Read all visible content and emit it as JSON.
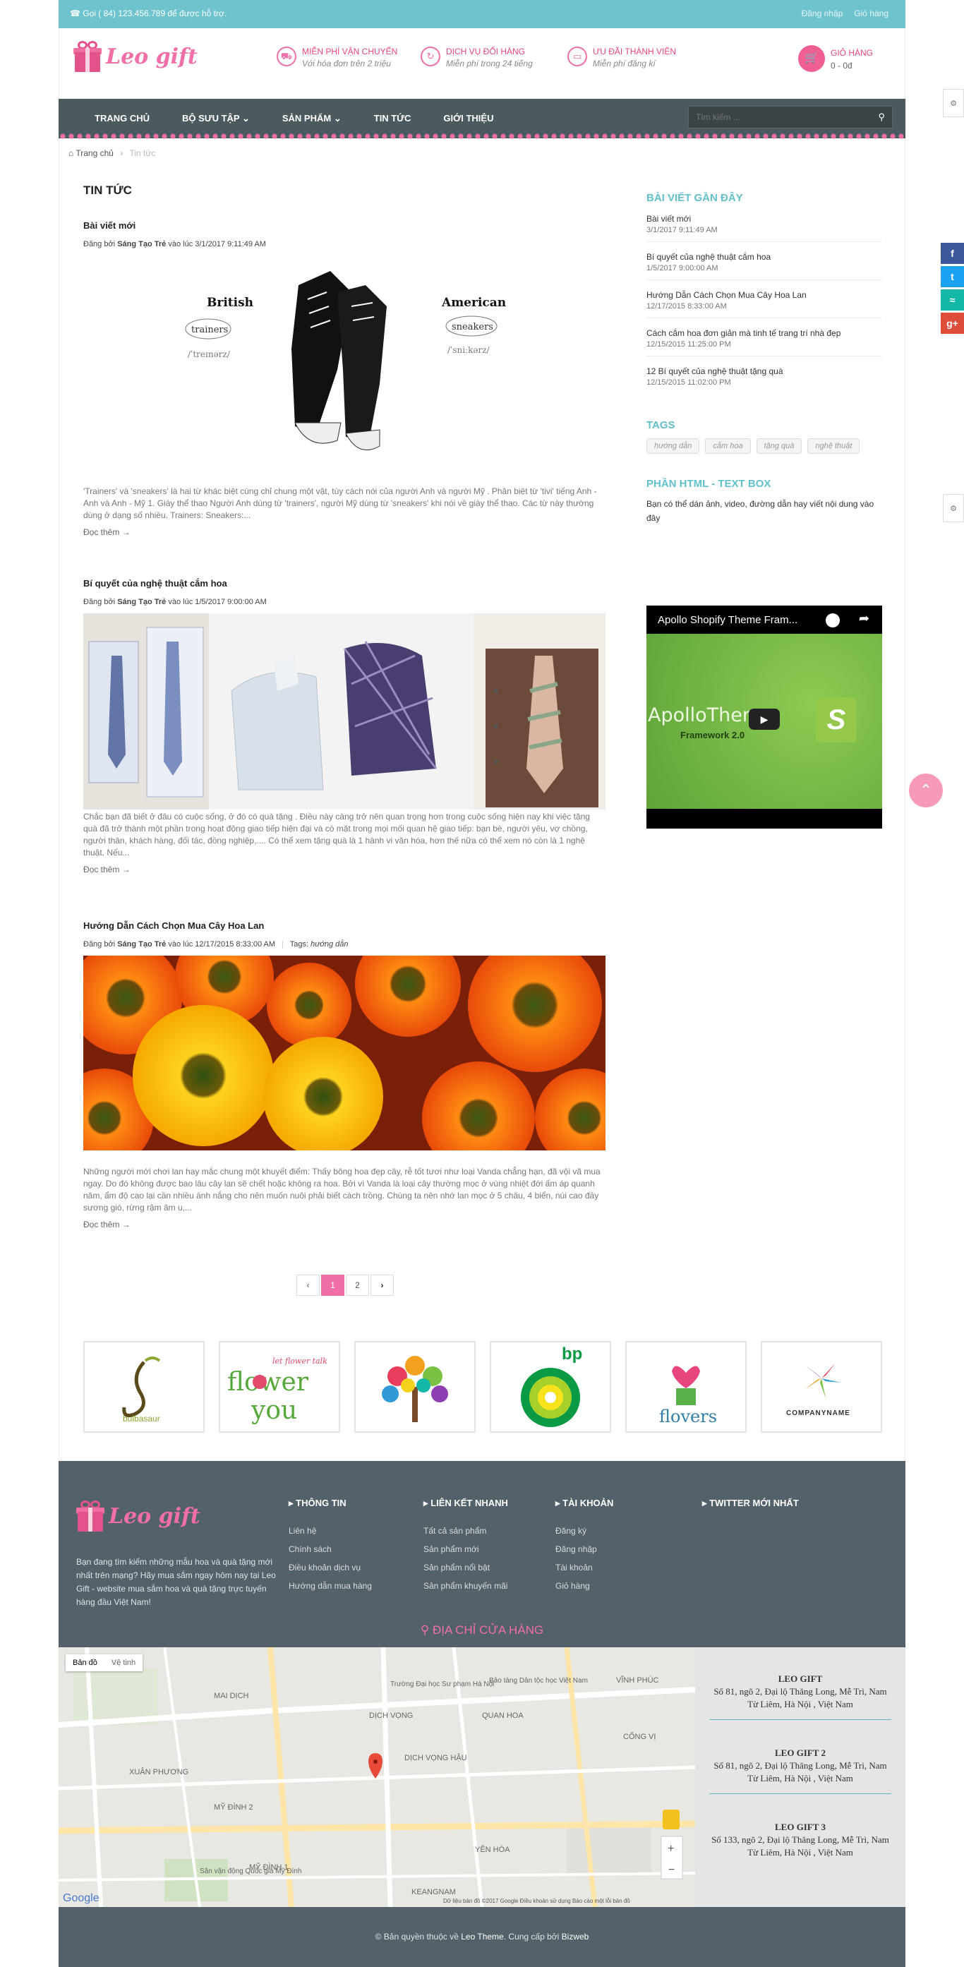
{
  "topbar": {
    "hotline": "Gọi ( 84) 123.456.789 để được hỗ trợ.",
    "login": "Đăng nhập",
    "cart": "Giỏ hàng"
  },
  "header": {
    "logo": "Leo gift",
    "features": [
      {
        "title": "MIỄN PHÍ VẬN CHUYỂN",
        "sub": "Với hóa đơn trên 2 triệu",
        "icon": "truck-icon"
      },
      {
        "title": "DỊCH VỤ ĐỔI HÀNG",
        "sub": "Miễn phí trong 24 tiếng",
        "icon": "refresh-icon"
      },
      {
        "title": "ƯU ĐÃI THÀNH VIÊN",
        "sub": "Miễn phí đăng kí",
        "icon": "card-icon"
      }
    ],
    "cart_title": "GIỎ HÀNG",
    "cart_count": "0 - 0đ"
  },
  "nav": {
    "items": [
      "TRANG CHỦ",
      "BỘ SƯU TẬP",
      "SẢN PHẨM",
      "TIN TỨC",
      "GIỚI THIỆU"
    ],
    "search_placeholder": "Tìm kiếm ..."
  },
  "breadcrumb": {
    "home": "Trang chủ",
    "current": "Tin tức"
  },
  "page_title": "TIN TỨC",
  "posts": [
    {
      "title": "Bài viết mới",
      "meta_prefix": "Đăng bởi",
      "author": "Sáng Tạo Trẻ",
      "date": "vào lúc 3/1/2017 9:11:49 AM",
      "tags_label": "",
      "tag": "",
      "excerpt": "'Trainers' và 'sneakers' là hai từ khác biệt cùng chỉ chung một vật, tùy cách nói của người Anh và người Mỹ . Phân biệt từ 'tivi' tiếng Anh - Anh và Anh - Mỹ 1. Giày thể thao Người Anh dùng từ 'trainers', người Mỹ dùng từ 'sneakers' khi nói về giày thể thao. Các từ này thường dùng ở dạng số nhiều. Trainers: Sneakers:...",
      "image": {
        "left_word": "British",
        "left_tag": "trainers",
        "left_ipa": "/ˈtreɪnərz/",
        "right_word": "American",
        "right_tag": "sneakers",
        "right_ipa": "/ˈsniːkərz/"
      }
    },
    {
      "title": "Bí quyết của nghệ thuật cắm hoa",
      "meta_prefix": "Đăng bởi",
      "author": "Sáng Tạo Trẻ",
      "date": "vào lúc 1/5/2017 9:00:00 AM",
      "tags_label": "",
      "tag": "",
      "excerpt": "Chắc bạn đã biết ở đâu có cuộc sống, ở đó có quà tặng . Điều này càng trở nên quan trọng hơn trong cuộc sống hiện nay khi việc tặng quà đã trở thành một phần trong hoạt động giao tiếp hiện đại và có mặt trong mọi mối quan hệ giao tiếp: bạn bè, người yêu, vợ chồng, người thân, khách hàng, đối tác, đồng nghiệp,.... Có thể xem tặng quà là 1 hành vi văn hóa, hơn thế nữa có thể xem nó còn là 1 nghệ thuật. Nếu..."
    },
    {
      "title": "Hướng Dẫn Cách Chọn Mua Cây Hoa Lan",
      "meta_prefix": "Đăng bởi",
      "author": "Sáng Tạo Trẻ",
      "date": "vào lúc 12/17/2015 8:33:00 AM",
      "tags_label": "Tags:",
      "tag": "hướng dẫn",
      "excerpt": "Những người mới chơi lan hay mắc chung một khuyết điểm: Thấy bông hoa đẹp cây, rễ tốt tươi như loại Vanda chẳng hạn, đã vội vã mua ngay. Do đó không được bao lâu cây lan sẽ chết hoặc không ra hoa. Bởi vì Vanda là loại cây thường mọc ở vùng nhiệt đới ấm áp quanh năm, ẩm độ cao lại cần nhiều ánh nắng cho nên muốn nuôi phải biết cách trồng. Chúng ta nên nhớ lan mọc ở 5 châu, 4 biển, núi cao đầy sương gió, rừng rậm âm u,..."
    }
  ],
  "read_more": "Đọc thêm →",
  "pagination": {
    "prev": "‹",
    "pages": [
      "1",
      "2"
    ],
    "next": "›"
  },
  "sidebar": {
    "recent_title": "BÀI VIẾT GẦN ĐÂY",
    "recent": [
      {
        "t": "Bài viết mới",
        "d": "3/1/2017 9:11:49 AM"
      },
      {
        "t": "Bí quyết của nghệ thuật cắm hoa",
        "d": "1/5/2017 9:00:00 AM"
      },
      {
        "t": "Hướng Dẫn Cách Chọn Mua Cây Hoa Lan",
        "d": "12/17/2015 8:33:00 AM"
      },
      {
        "t": "Cách cắm hoa đơn giản mà tinh tế trang trí nhà đẹp",
        "d": "12/15/2015 11:25:00 PM"
      },
      {
        "t": "12 Bí quyết của nghệ thuật tặng quà",
        "d": "12/15/2015 11:02:00 PM"
      }
    ],
    "tags_title": "TAGS",
    "tags": [
      "hướng dẫn",
      "cắm hoa",
      "tặng quà",
      "nghệ thuật"
    ],
    "html_title": "PHẦN HTML - TEXT BOX",
    "html_text": "Bạn có thể dán ảnh, video, đường dẫn hay viết nội dung vào đây",
    "video_title": "Apollo Shopify Theme Fram...",
    "video_brand": "ApolloTheme",
    "video_sub": "Framework 2.0"
  },
  "partners": [
    "bulbasaur",
    "let flower talk",
    "tree",
    "bp",
    "flovers",
    "COMPANYNAME"
  ],
  "footer": {
    "logo": "Leo gift",
    "about": "Bạn đang tìm kiếm những mẫu hoa và quà tặng mới nhất trên mạng? Hãy mua sắm ngay hôm nay tại Leo Gift - website mua sắm hoa và quà tặng trực tuyến hàng đầu Việt Nam!",
    "cols": [
      {
        "title": "THÔNG TIN",
        "items": [
          "Liên hệ",
          "Chính sách",
          "Điều khoản dịch vụ",
          "Hướng dẫn mua hàng"
        ]
      },
      {
        "title": "LIÊN KẾT NHANH",
        "items": [
          "Tất cả sản phẩm",
          "Sản phẩm mới",
          "Sản phẩm nổi bật",
          "Sản phẩm khuyến mãi"
        ]
      },
      {
        "title": "TÀI KHOẢN",
        "items": [
          "Đăng ký",
          "Đăng nhập",
          "Tài khoản",
          "Giỏ hàng"
        ]
      },
      {
        "title": "TWITTER MỚI NHẤT",
        "items": []
      }
    ],
    "address_title": "ĐỊA CHỈ CỬA HÀNG"
  },
  "map": {
    "tab_map": "Bản đồ",
    "tab_sat": "Vệ tinh",
    "labels": [
      "MAI DỊCH",
      "DỊCH VỌNG",
      "QUAN HOA",
      "DỊCH VỌNG HẬU",
      "XUÂN PHƯƠNG",
      "MỸ ĐÌNH 2",
      "MỸ ĐÌNH 1",
      "YÊN HÒA",
      "VĨNH PHÚC",
      "CỐNG VỊ",
      "KEANGNAM",
      "Sân vận động Quốc gia Mỹ Đình",
      "Trường Đại học Sư phạm Hà Nội",
      "Bảo tàng Dân tộc học Việt Nam",
      "Google"
    ],
    "footer": "Dữ liệu bản đồ ©2017 Google   Điều khoản sử dụng   Báo cáo một lỗi bản đồ"
  },
  "stores": [
    {
      "name": "LEO GIFT",
      "addr": "Số 81, ngõ 2, Đại lộ Thăng Long, Mễ Trì, Nam Từ Liêm, Hà Nội , Việt Nam"
    },
    {
      "name": "LEO GIFT 2",
      "addr": "Số 81, ngõ 2, Đại lộ Thăng Long, Mễ Trì, Nam Từ Liêm, Hà Nội , Việt Nam"
    },
    {
      "name": "LEO GIFT 3",
      "addr": "Số 133, ngõ 2, Đại lộ Thăng Long, Mễ Trì, Nam Từ Liêm, Hà Nội , Việt Nam"
    }
  ],
  "copyright": {
    "text": "© Bản quyền thuộc về",
    "brand": "Leo Theme",
    "mid": ". Cung cấp bởi",
    "provider": "Bizweb"
  },
  "colors": {
    "accent": "#f06fa6",
    "teal": "#6fc3cc",
    "dark": "#53616a"
  }
}
